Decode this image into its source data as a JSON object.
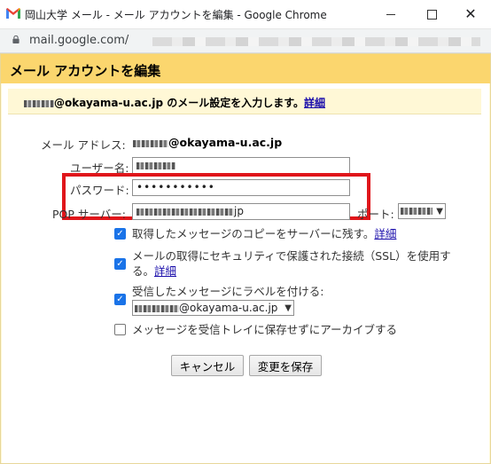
{
  "window": {
    "title": "岡山大学 メール - メール アカウントを編集 - Google Chrome",
    "url": "mail.google.com/"
  },
  "dialog": {
    "title": "メール アカウントを編集",
    "intro_domain": "@okayama-u.ac.jp",
    "intro_text": " のメール設定を入力します。",
    "intro_link": "詳細",
    "email_label": "メール アドレス:",
    "email_domain": "@okayama-u.ac.jp",
    "username_label": "ユーザー名:",
    "password_label": "パスワード:",
    "password_value": "•••••••••••",
    "pop_label": "POP サーバー:",
    "pop_value_suffix": "jp",
    "port_label": "ポート:",
    "leave_copy_text": "取得したメッセージのコピーをサーバーに残す。",
    "leave_copy_link": "詳細",
    "ssl_text_line1": "メールの取得にセキュリティで保護された接続（SSL）を使用す",
    "ssl_text_line2": "る。",
    "ssl_link": "詳細",
    "label_text": "受信したメッセージにラベルを付ける:",
    "label_value": "@okayama-u.ac.jp",
    "archive_text": "メッセージを受信トレイに保存せずにアーカイブする",
    "cancel_label": "キャンセル",
    "save_label": "変更を保存"
  },
  "checkboxes": {
    "leave_copy": true,
    "ssl": true,
    "label": true,
    "archive": false
  },
  "colors": {
    "header_bg": "#fbd66e",
    "highlight_border": "#e0161b",
    "checkbox_on": "#1a73e8",
    "link": "#1a0dab"
  }
}
